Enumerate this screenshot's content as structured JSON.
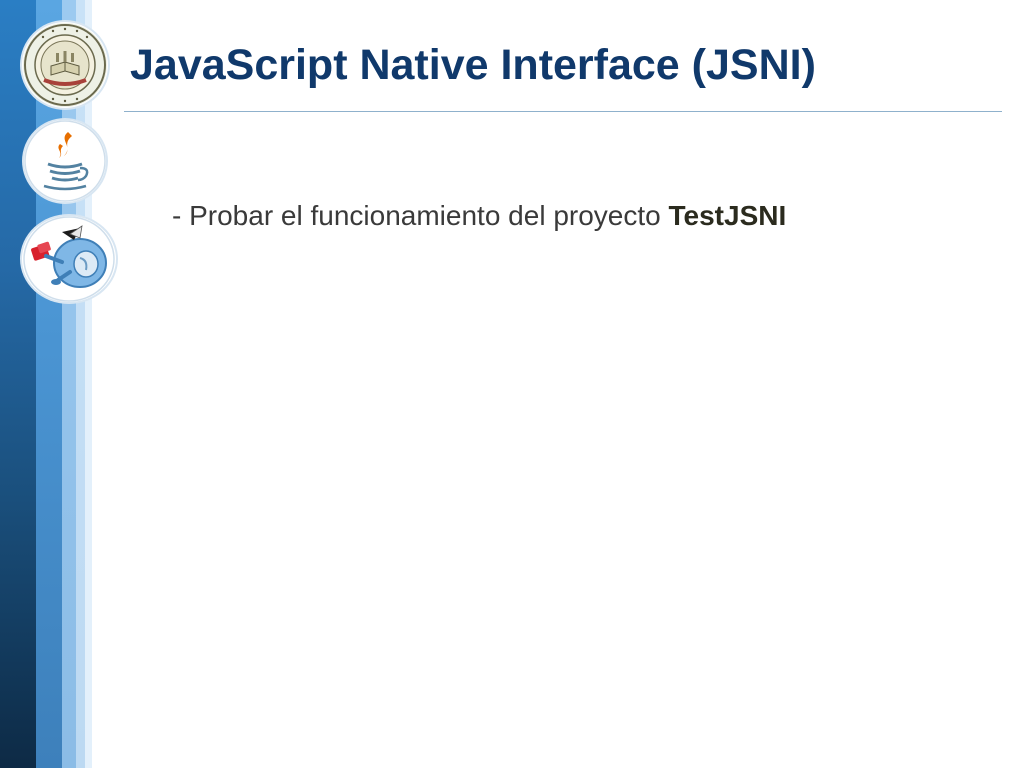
{
  "slide": {
    "title": "JavaScript Native Interface (JSNI)",
    "bullet": {
      "prefix": "- Probar el funcionamiento del proyecto ",
      "emphasis": "TestJSNI"
    }
  },
  "logos": {
    "university_seal": {
      "icon": "university-seal-icon",
      "top_text": "UNIVERSIDAD NACIONAL DE ASUNCION",
      "inner_text": "FACULTAD POLITECNICA",
      "band_text": "PARAGUAY",
      "bottom_text": "REPUBLICA DEL PARAGUAY"
    },
    "java": {
      "icon": "java-coffee-cup-icon"
    },
    "gwt": {
      "icon": "gwt-toolbox-icon"
    }
  },
  "colors": {
    "title": "#10396b",
    "body_text": "#3a3a3a",
    "rule": "#8fb1cc",
    "bar_dark": "#1a4f7c",
    "bar_mid": "#4a94d2",
    "bar_light": "#9ccaf0"
  }
}
